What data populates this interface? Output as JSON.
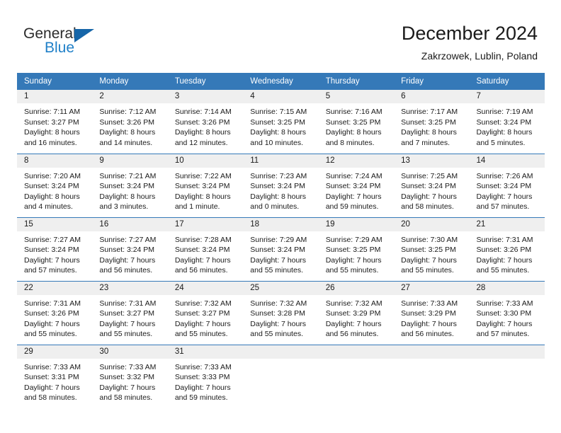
{
  "brand": {
    "name_top": "General",
    "name_bottom": "Blue",
    "triangle_icon": "blue-triangle-icon",
    "color_dark": "#2b2b2b",
    "color_blue": "#2080c8"
  },
  "header": {
    "title": "December 2024",
    "subtitle": "Zakrzowek, Lublin, Poland"
  },
  "theme": {
    "header_bg": "#3579b8",
    "daynum_bg": "#efefef",
    "cell_bg": "#ffffff",
    "text": "#1a1a1a"
  },
  "weekday_headers": [
    "Sunday",
    "Monday",
    "Tuesday",
    "Wednesday",
    "Thursday",
    "Friday",
    "Saturday"
  ],
  "weeks": [
    [
      {
        "day": "1",
        "sunrise": "Sunrise: 7:11 AM",
        "sunset": "Sunset: 3:27 PM",
        "daylight1": "Daylight: 8 hours",
        "daylight2": "and 16 minutes."
      },
      {
        "day": "2",
        "sunrise": "Sunrise: 7:12 AM",
        "sunset": "Sunset: 3:26 PM",
        "daylight1": "Daylight: 8 hours",
        "daylight2": "and 14 minutes."
      },
      {
        "day": "3",
        "sunrise": "Sunrise: 7:14 AM",
        "sunset": "Sunset: 3:26 PM",
        "daylight1": "Daylight: 8 hours",
        "daylight2": "and 12 minutes."
      },
      {
        "day": "4",
        "sunrise": "Sunrise: 7:15 AM",
        "sunset": "Sunset: 3:25 PM",
        "daylight1": "Daylight: 8 hours",
        "daylight2": "and 10 minutes."
      },
      {
        "day": "5",
        "sunrise": "Sunrise: 7:16 AM",
        "sunset": "Sunset: 3:25 PM",
        "daylight1": "Daylight: 8 hours",
        "daylight2": "and 8 minutes."
      },
      {
        "day": "6",
        "sunrise": "Sunrise: 7:17 AM",
        "sunset": "Sunset: 3:25 PM",
        "daylight1": "Daylight: 8 hours",
        "daylight2": "and 7 minutes."
      },
      {
        "day": "7",
        "sunrise": "Sunrise: 7:19 AM",
        "sunset": "Sunset: 3:24 PM",
        "daylight1": "Daylight: 8 hours",
        "daylight2": "and 5 minutes."
      }
    ],
    [
      {
        "day": "8",
        "sunrise": "Sunrise: 7:20 AM",
        "sunset": "Sunset: 3:24 PM",
        "daylight1": "Daylight: 8 hours",
        "daylight2": "and 4 minutes."
      },
      {
        "day": "9",
        "sunrise": "Sunrise: 7:21 AM",
        "sunset": "Sunset: 3:24 PM",
        "daylight1": "Daylight: 8 hours",
        "daylight2": "and 3 minutes."
      },
      {
        "day": "10",
        "sunrise": "Sunrise: 7:22 AM",
        "sunset": "Sunset: 3:24 PM",
        "daylight1": "Daylight: 8 hours",
        "daylight2": "and 1 minute."
      },
      {
        "day": "11",
        "sunrise": "Sunrise: 7:23 AM",
        "sunset": "Sunset: 3:24 PM",
        "daylight1": "Daylight: 8 hours",
        "daylight2": "and 0 minutes."
      },
      {
        "day": "12",
        "sunrise": "Sunrise: 7:24 AM",
        "sunset": "Sunset: 3:24 PM",
        "daylight1": "Daylight: 7 hours",
        "daylight2": "and 59 minutes."
      },
      {
        "day": "13",
        "sunrise": "Sunrise: 7:25 AM",
        "sunset": "Sunset: 3:24 PM",
        "daylight1": "Daylight: 7 hours",
        "daylight2": "and 58 minutes."
      },
      {
        "day": "14",
        "sunrise": "Sunrise: 7:26 AM",
        "sunset": "Sunset: 3:24 PM",
        "daylight1": "Daylight: 7 hours",
        "daylight2": "and 57 minutes."
      }
    ],
    [
      {
        "day": "15",
        "sunrise": "Sunrise: 7:27 AM",
        "sunset": "Sunset: 3:24 PM",
        "daylight1": "Daylight: 7 hours",
        "daylight2": "and 57 minutes."
      },
      {
        "day": "16",
        "sunrise": "Sunrise: 7:27 AM",
        "sunset": "Sunset: 3:24 PM",
        "daylight1": "Daylight: 7 hours",
        "daylight2": "and 56 minutes."
      },
      {
        "day": "17",
        "sunrise": "Sunrise: 7:28 AM",
        "sunset": "Sunset: 3:24 PM",
        "daylight1": "Daylight: 7 hours",
        "daylight2": "and 56 minutes."
      },
      {
        "day": "18",
        "sunrise": "Sunrise: 7:29 AM",
        "sunset": "Sunset: 3:24 PM",
        "daylight1": "Daylight: 7 hours",
        "daylight2": "and 55 minutes."
      },
      {
        "day": "19",
        "sunrise": "Sunrise: 7:29 AM",
        "sunset": "Sunset: 3:25 PM",
        "daylight1": "Daylight: 7 hours",
        "daylight2": "and 55 minutes."
      },
      {
        "day": "20",
        "sunrise": "Sunrise: 7:30 AM",
        "sunset": "Sunset: 3:25 PM",
        "daylight1": "Daylight: 7 hours",
        "daylight2": "and 55 minutes."
      },
      {
        "day": "21",
        "sunrise": "Sunrise: 7:31 AM",
        "sunset": "Sunset: 3:26 PM",
        "daylight1": "Daylight: 7 hours",
        "daylight2": "and 55 minutes."
      }
    ],
    [
      {
        "day": "22",
        "sunrise": "Sunrise: 7:31 AM",
        "sunset": "Sunset: 3:26 PM",
        "daylight1": "Daylight: 7 hours",
        "daylight2": "and 55 minutes."
      },
      {
        "day": "23",
        "sunrise": "Sunrise: 7:31 AM",
        "sunset": "Sunset: 3:27 PM",
        "daylight1": "Daylight: 7 hours",
        "daylight2": "and 55 minutes."
      },
      {
        "day": "24",
        "sunrise": "Sunrise: 7:32 AM",
        "sunset": "Sunset: 3:27 PM",
        "daylight1": "Daylight: 7 hours",
        "daylight2": "and 55 minutes."
      },
      {
        "day": "25",
        "sunrise": "Sunrise: 7:32 AM",
        "sunset": "Sunset: 3:28 PM",
        "daylight1": "Daylight: 7 hours",
        "daylight2": "and 55 minutes."
      },
      {
        "day": "26",
        "sunrise": "Sunrise: 7:32 AM",
        "sunset": "Sunset: 3:29 PM",
        "daylight1": "Daylight: 7 hours",
        "daylight2": "and 56 minutes."
      },
      {
        "day": "27",
        "sunrise": "Sunrise: 7:33 AM",
        "sunset": "Sunset: 3:29 PM",
        "daylight1": "Daylight: 7 hours",
        "daylight2": "and 56 minutes."
      },
      {
        "day": "28",
        "sunrise": "Sunrise: 7:33 AM",
        "sunset": "Sunset: 3:30 PM",
        "daylight1": "Daylight: 7 hours",
        "daylight2": "and 57 minutes."
      }
    ],
    [
      {
        "day": "29",
        "sunrise": "Sunrise: 7:33 AM",
        "sunset": "Sunset: 3:31 PM",
        "daylight1": "Daylight: 7 hours",
        "daylight2": "and 58 minutes."
      },
      {
        "day": "30",
        "sunrise": "Sunrise: 7:33 AM",
        "sunset": "Sunset: 3:32 PM",
        "daylight1": "Daylight: 7 hours",
        "daylight2": "and 58 minutes."
      },
      {
        "day": "31",
        "sunrise": "Sunrise: 7:33 AM",
        "sunset": "Sunset: 3:33 PM",
        "daylight1": "Daylight: 7 hours",
        "daylight2": "and 59 minutes."
      },
      {
        "day": "",
        "sunrise": "",
        "sunset": "",
        "daylight1": "",
        "daylight2": ""
      },
      {
        "day": "",
        "sunrise": "",
        "sunset": "",
        "daylight1": "",
        "daylight2": ""
      },
      {
        "day": "",
        "sunrise": "",
        "sunset": "",
        "daylight1": "",
        "daylight2": ""
      },
      {
        "day": "",
        "sunrise": "",
        "sunset": "",
        "daylight1": "",
        "daylight2": ""
      }
    ]
  ]
}
